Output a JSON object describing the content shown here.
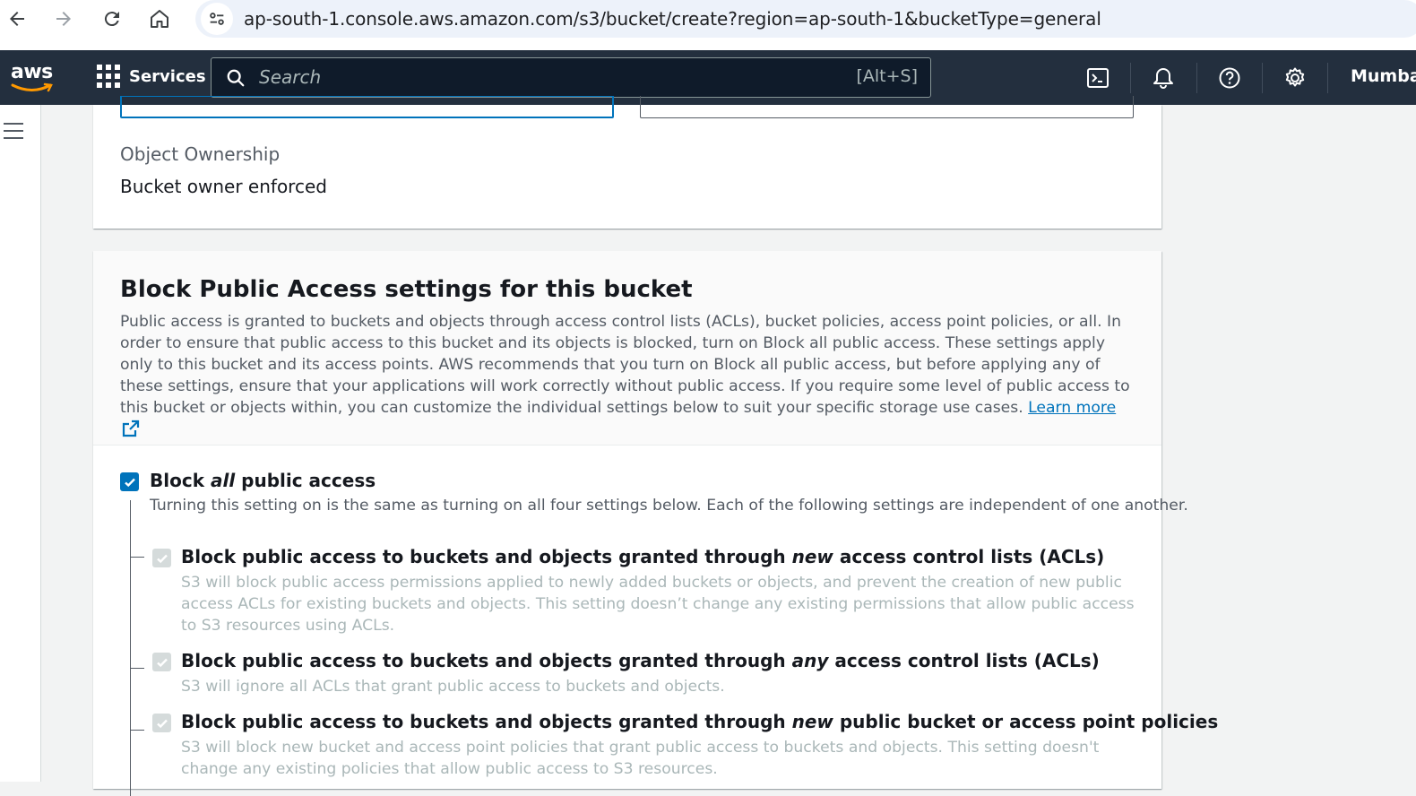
{
  "browser": {
    "url": "ap-south-1.console.aws.amazon.com/s3/bucket/create?region=ap-south-1&bucketType=general"
  },
  "aws_nav": {
    "logo": "aws",
    "services_label": "Services",
    "search_placeholder": "Search",
    "search_shortcut": "[Alt+S]",
    "region": "Mumbai",
    "icons": [
      "cloudshell-icon",
      "notifications-icon",
      "help-icon",
      "settings-icon"
    ]
  },
  "object_ownership": {
    "label": "Object Ownership",
    "value": "Bucket owner enforced"
  },
  "block_public_access": {
    "title": "Block Public Access settings for this bucket",
    "description": "Public access is granted to buckets and objects through access control lists (ACLs), bucket policies, access point policies, or all. In order to ensure that public access to this bucket and its objects is blocked, turn on Block all public access. These settings apply only to this bucket and its access points. AWS recommends that you turn on Block all public access, but before applying any of these settings, ensure that your applications will work correctly without public access. If you require some level of public access to this bucket or objects within, you can customize the individual settings below to suit your specific storage use cases.",
    "learn_more": "Learn more",
    "block_all": {
      "title_prefix": "Block ",
      "title_em": "all",
      "title_suffix": " public access",
      "description": "Turning this setting on is the same as turning on all four settings below. Each of the following settings are independent of one another.",
      "checked": true
    },
    "options": [
      {
        "title_prefix": "Block public access to buckets and objects granted through ",
        "title_em": "new",
        "title_suffix": " access control lists (ACLs)",
        "description": "S3 will block public access permissions applied to newly added buckets or objects, and prevent the creation of new public access ACLs for existing buckets and objects. This setting doesn’t change any existing permissions that allow public access to S3 resources using ACLs.",
        "checked": true
      },
      {
        "title_prefix": "Block public access to buckets and objects granted through ",
        "title_em": "any",
        "title_suffix": " access control lists (ACLs)",
        "description": "S3 will ignore all ACLs that grant public access to buckets and objects.",
        "checked": true
      },
      {
        "title_prefix": "Block public access to buckets and objects granted through ",
        "title_em": "new",
        "title_suffix": " public bucket or access point policies",
        "description": "S3 will block new bucket and access point policies that grant public access to buckets and objects. This setting doesn't change any existing policies that allow public access to S3 resources.",
        "checked": true
      }
    ]
  }
}
